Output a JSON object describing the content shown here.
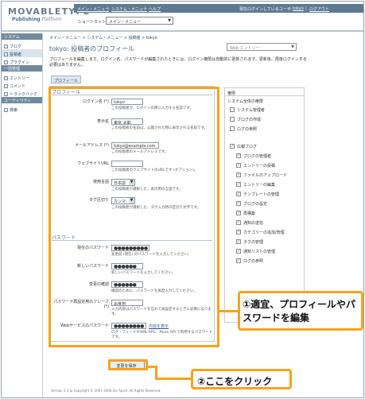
{
  "header": {
    "logo_main": "MOVABLETYPE",
    "logo_sub_brand": "Publishing",
    "logo_sub_rest": " Platform",
    "nav_main_menu": "メイン・メニュー",
    "nav_system_menu": "システム・メニュー",
    "nav_help": "ヘルプ",
    "nav_sep": "|",
    "login_text": "現在ログインしているユーザ:",
    "login_user": "tokyo",
    "logout": "ログアウト",
    "shortcut_label": "ショートカット:",
    "shortcut_value": "メイン・メニュー"
  },
  "sidebar": {
    "sections": [
      {
        "title": "システム",
        "items": [
          {
            "label": "ブログ",
            "icon": "blog-icon",
            "active": false
          },
          {
            "label": "投稿者",
            "icon": "user-icon",
            "active": true
          },
          {
            "label": "プラグイン",
            "icon": "plugin-icon",
            "active": false
          }
        ]
      },
      {
        "title": "一括管理",
        "items": [
          {
            "label": "エントリー",
            "icon": "entry-icon",
            "active": false
          },
          {
            "label": "コメント",
            "icon": "comment-icon",
            "active": false
          },
          {
            "label": "トラックバック",
            "icon": "trackback-icon",
            "active": false
          }
        ]
      },
      {
        "title": "ユーティリティ",
        "items": [
          {
            "label": "検索",
            "icon": "search-icon",
            "active": false
          }
        ]
      }
    ]
  },
  "main": {
    "breadcrumb": "メイン・メニュー > システム・メニュー > 投稿者 > tokyo",
    "title": "tokyo: 投稿者のプロフィール",
    "search_placeholder": "Web エントリー",
    "description": "プロフィールを編集します。ログイン名、パスワードが編集されたときには、ログイン権限は自動的に更新されます。更新後、再度ログインする必要はありません。",
    "tab_profile": "プロフィール"
  },
  "profile": {
    "section_title": "プロフィール",
    "login_name_label": "ログイン名 (*)",
    "login_name_value": "tokyo",
    "login_name_help": "この投稿者が、ログインの際に入力する名前です。",
    "display_name_label": "表示名",
    "display_name_value": "東京 太郎",
    "display_name_help": "この投稿者の名前は、公開された際に表示される名前です。",
    "email_label": "メールアドレス (*)",
    "email_value": "tokyo@example.com",
    "email_help": "この投稿者のメールアドレスです。",
    "website_label": "ウェブサイトURL",
    "website_value": "",
    "website_help": "この投稿者のウェブサイトのURLです (オプション)。",
    "language_label": "使用言語",
    "language_value": "日本語",
    "language_help": "この投稿者が選択した、表示用の言語です。",
    "tag_delim_label": "タグ区切り",
    "tag_delim_value": "カンマ",
    "tag_delim_help": "この投稿者が選択した、タグ入力時の区切り文字です。"
  },
  "password": {
    "section_title": "パスワード",
    "current_label": "現在のパスワード",
    "current_value": "●●●●●●●●●",
    "current_help": "変更前 (現在) のパスワードを入力してください。",
    "new_label": "新しいパスワード",
    "new_value": "●●●●●●",
    "new_help": "新しいパスワードを入力してください。",
    "confirm_label": "変更の確認",
    "confirm_value": "●●●●●●",
    "confirm_help": "確認のために、パスワードを再度入力してください。",
    "hint_label": "パスワード再設定用のフレーズ (*)",
    "hint_value": "出身地",
    "hint_help": "入力内容はパスワードを忘れて再設定するときに必要になります。",
    "webservice_label": "Webサービスのパスワード",
    "webservice_value": "●●●●●●●●",
    "webservice_link": "内容を表示",
    "webservice_help": "ログ・フィードやXML-RPC、Atom API で利用するパスワードです。"
  },
  "permissions": {
    "header": "権限",
    "system_label": "システム全体の権限",
    "system_items": [
      {
        "label": "システム管理者",
        "checked": false
      },
      {
        "label": "ブログの作成",
        "checked": false
      },
      {
        "label": "ログの参照",
        "checked": false
      }
    ],
    "blog_role": {
      "label": "広報ブログ",
      "checked": true
    },
    "blog_items": [
      {
        "label": "ブログの管理者",
        "checked": true
      },
      {
        "label": "エントリーの投稿",
        "checked": true
      },
      {
        "label": "ファイルのアップロード",
        "checked": true
      },
      {
        "label": "エントリーの編集",
        "checked": true
      },
      {
        "label": "テンプレートの管理",
        "checked": true
      },
      {
        "label": "ブログの設定",
        "checked": true
      },
      {
        "label": "再構築",
        "checked": true
      },
      {
        "label": "通知の送信",
        "checked": true
      },
      {
        "label": "カテゴリーの追加/管理",
        "checked": true
      },
      {
        "label": "タグの管理",
        "checked": true
      },
      {
        "label": "通知リストの管理",
        "checked": true
      },
      {
        "label": "ログの参照",
        "checked": true
      }
    ]
  },
  "save_button": "変更を保存",
  "footer": "Version 3.3-ja Copyright © 2001-2006 Six Apart. All Rights Reserved.",
  "annotations": {
    "callout1": "①適宜、プロフィールやパスワードを編集",
    "callout2": "②ここをクリック",
    "color": "#f7a21b"
  }
}
